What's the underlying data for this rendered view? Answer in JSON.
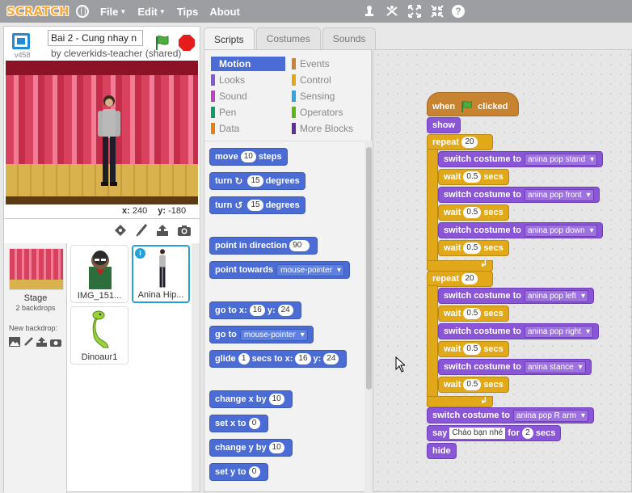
{
  "menubar": {
    "logo": "SCRATCH",
    "file": "File",
    "edit": "Edit",
    "tips": "Tips",
    "about": "About"
  },
  "stage": {
    "version": "v458",
    "project_title": "Bai 2 - Cung nhay n",
    "byline": "by cleverkids-teacher (shared)",
    "x_label": "x:",
    "x_value": "240",
    "y_label": "y:",
    "y_value": "-180"
  },
  "sprites": {
    "stage_label": "Stage",
    "backdrops": "2 backdrops",
    "new_backdrop": "New backdrop:",
    "items": [
      {
        "name": "IMG_151..."
      },
      {
        "name": "Anina Hip..."
      },
      {
        "name": "Dinoaur1"
      }
    ],
    "info": "i"
  },
  "tabs": {
    "scripts": "Scripts",
    "costumes": "Costumes",
    "sounds": "Sounds"
  },
  "categories": {
    "motion": "Motion",
    "looks": "Looks",
    "sound": "Sound",
    "pen": "Pen",
    "data": "Data",
    "events": "Events",
    "control": "Control",
    "sensing": "Sensing",
    "operators": "Operators",
    "more_blocks": "More Blocks",
    "colors": {
      "motion": "#4a6cd4",
      "looks": "#8a55d7",
      "sound": "#bb42c3",
      "pen": "#0e9a6c",
      "data": "#ee7d16",
      "events": "#c88330",
      "control": "#e1a91a",
      "sensing": "#2ca5e2",
      "operators": "#5cb712",
      "more_blocks": "#632d99"
    }
  },
  "palette": {
    "move": "move",
    "move_n": "10",
    "steps": "steps",
    "turn": "turn",
    "turn_cw_n": "15",
    "turn_ccw_n": "15",
    "degrees": "degrees",
    "point_in_direction": "point in direction",
    "direction_n": "90",
    "point_towards": "point towards",
    "towards_target": "mouse-pointer",
    "go_to_xy": "go to x:",
    "goto_x": "16",
    "y_label": "y:",
    "goto_y": "24",
    "go_to": "go to",
    "goto_target": "mouse-pointer",
    "glide": "glide",
    "glide_n": "1",
    "secs_to_x": "secs to x:",
    "glide_x": "16",
    "glide_y": "24",
    "change_x_by": "change x by",
    "change_x_n": "10",
    "set_x_to": "set x to",
    "set_x_n": "0",
    "change_y_by": "change y by",
    "change_y_n": "10",
    "set_y_to": "set y to",
    "set_y_n": "0"
  },
  "script": {
    "when": "when",
    "clicked": "clicked",
    "show": "show",
    "repeat": "repeat",
    "repeat1_n": "20",
    "repeat2_n": "20",
    "switch_costume_to": "switch costume to",
    "wait": "wait",
    "secs": "secs",
    "wait_n": "0.5",
    "costumes1": [
      "anina pop stand",
      "anina pop front",
      "anina pop down"
    ],
    "costumes2": [
      "anina pop left",
      "anina pop right",
      "anina stance"
    ],
    "final_costume": "anina pop R arm",
    "say": "say",
    "say_text": "Chào bạn nhé",
    "for": "for",
    "say_secs_n": "2",
    "hide": "hide"
  }
}
